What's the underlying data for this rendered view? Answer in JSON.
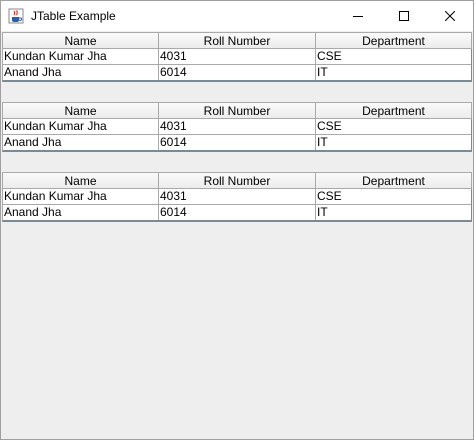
{
  "window": {
    "title": "JTable Example"
  },
  "tables": [
    {
      "columns": [
        "Name",
        "Roll Number",
        "Department"
      ],
      "rows": [
        [
          "Kundan Kumar Jha",
          "4031",
          "CSE"
        ],
        [
          "Anand Jha",
          "6014",
          "IT"
        ]
      ]
    },
    {
      "columns": [
        "Name",
        "Roll Number",
        "Department"
      ],
      "rows": [
        [
          "Kundan Kumar Jha",
          "4031",
          "CSE"
        ],
        [
          "Anand Jha",
          "6014",
          "IT"
        ]
      ]
    },
    {
      "columns": [
        "Name",
        "Roll Number",
        "Department"
      ],
      "rows": [
        [
          "Kundan Kumar Jha",
          "4031",
          "CSE"
        ],
        [
          "Anand Jha",
          "6014",
          "IT"
        ]
      ]
    }
  ],
  "icons": {
    "app": "java-cup-icon",
    "minimize": "minimize-icon",
    "maximize": "maximize-icon",
    "close": "close-icon"
  }
}
